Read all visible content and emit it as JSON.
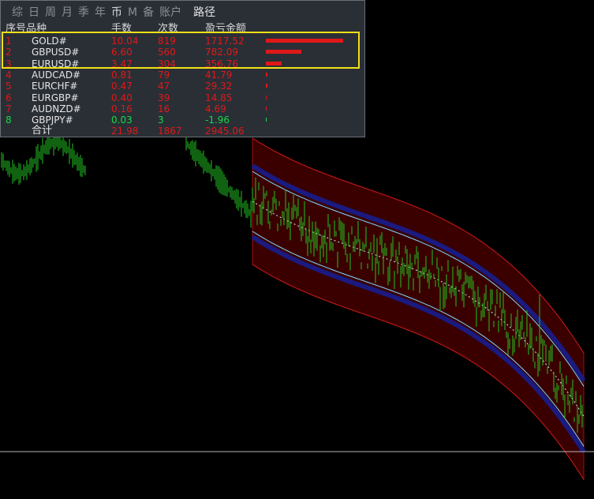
{
  "tabs": [
    {
      "label": "综"
    },
    {
      "label": "日"
    },
    {
      "label": "周"
    },
    {
      "label": "月"
    },
    {
      "label": "季"
    },
    {
      "label": "年"
    },
    {
      "label": "币"
    },
    {
      "label": "M"
    },
    {
      "label": "备"
    },
    {
      "label": "账户"
    }
  ],
  "path_tab": "路径",
  "headers": {
    "index": "序号",
    "symbol": "品种",
    "lots": "手数",
    "count": "次数",
    "pnl": "盈亏金额"
  },
  "rows": [
    {
      "index": "1",
      "symbol": "GOLD#",
      "lots": "10.04",
      "count": "819",
      "pnl": "1717.52",
      "ratio": 1.0,
      "color": "#e01818"
    },
    {
      "index": "2",
      "symbol": "GBPUSD#",
      "lots": "6.60",
      "count": "560",
      "pnl": "782.09",
      "ratio": 0.455,
      "color": "#e01818"
    },
    {
      "index": "3",
      "symbol": "EURUSD#",
      "lots": "3.47",
      "count": "304",
      "pnl": "356.76",
      "ratio": 0.208,
      "color": "#e01818"
    },
    {
      "index": "4",
      "symbol": "AUDCAD#",
      "lots": "0.81",
      "count": "79",
      "pnl": "41.79",
      "ratio": 0.024,
      "color": "#e01818"
    },
    {
      "index": "5",
      "symbol": "EURCHF#",
      "lots": "0.47",
      "count": "47",
      "pnl": "29.32",
      "ratio": 0.017,
      "color": "#e01818"
    },
    {
      "index": "6",
      "symbol": "EURGBP#",
      "lots": "0.40",
      "count": "39",
      "pnl": "14.85",
      "ratio": 0.009,
      "color": "#e01818"
    },
    {
      "index": "7",
      "symbol": "AUDNZD#",
      "lots": "0.16",
      "count": "16",
      "pnl": "4.69",
      "ratio": 0.003,
      "color": "#e01818"
    },
    {
      "index": "8",
      "symbol": "GBPJPY#",
      "lots": "0.03",
      "count": "3",
      "pnl": "-1.96",
      "ratio": 0.001,
      "color": "#18d848"
    }
  ],
  "total": {
    "label": "合计",
    "lots": "21.98",
    "count": "1867",
    "pnl": "2945.06"
  },
  "colors": {
    "profit": "#e01818",
    "loss": "#18d848",
    "highlight": "#f0e016",
    "candles": "#22c422",
    "channel": "#5a0000"
  }
}
